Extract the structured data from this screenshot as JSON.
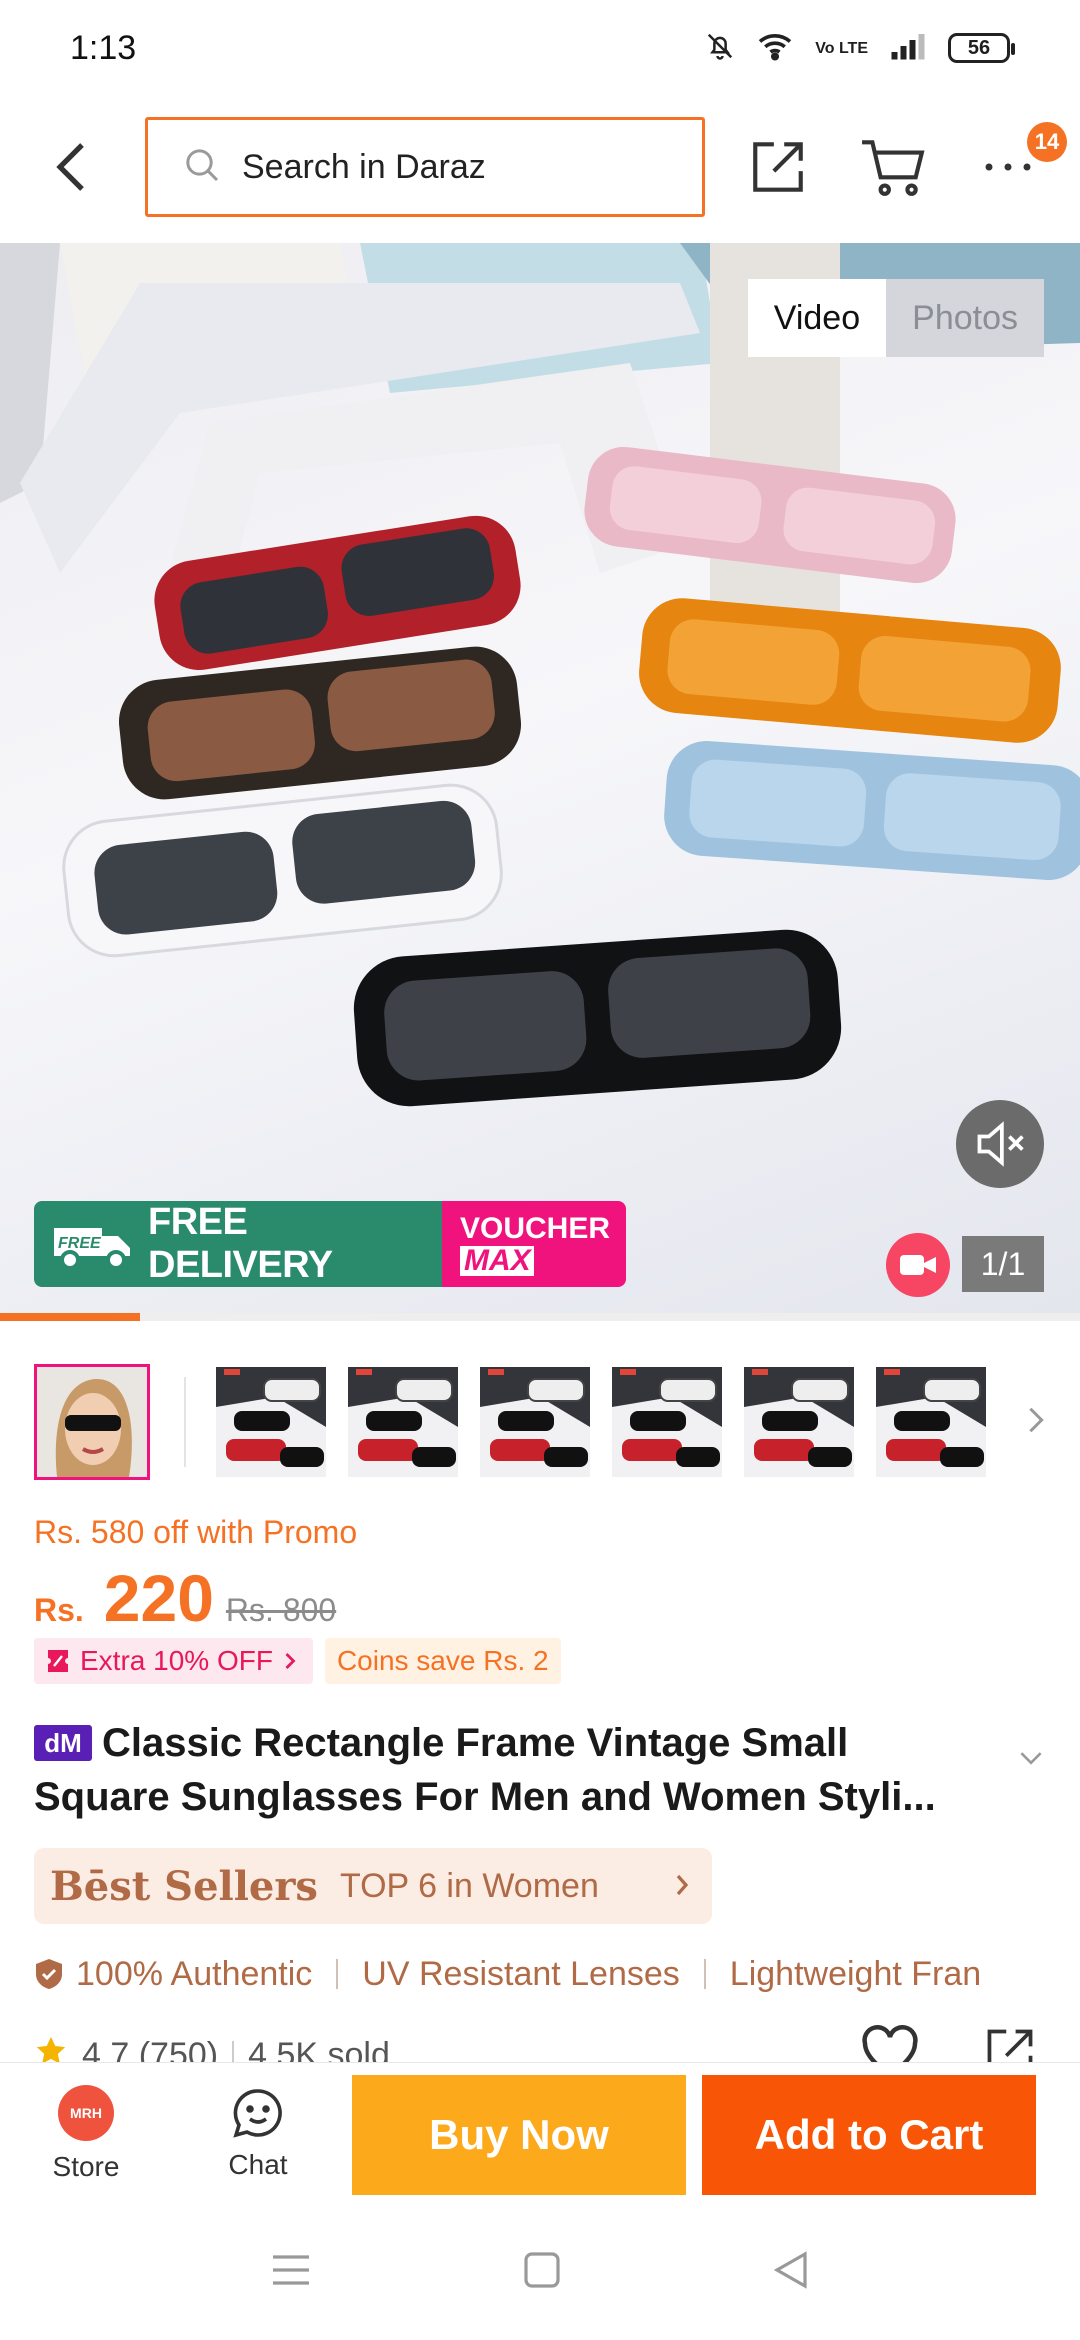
{
  "status_bar": {
    "time": "1:13",
    "network": "Vo LTE",
    "battery": "56"
  },
  "header": {
    "search_placeholder": "Search in Daraz",
    "cart_badge": "14"
  },
  "media": {
    "toggle_video": "Video",
    "toggle_photos": "Photos",
    "free_delivery": "FREE DELIVERY",
    "free_tag": "FREE",
    "voucher_line1": "VOUCHER",
    "voucher_line2": "MAX",
    "page_count": "1/1",
    "video_progress": 0.13
  },
  "thumbnails": {
    "count": 7,
    "selected_index": 0
  },
  "price": {
    "promo": "Rs. 580 off with Promo",
    "currency": "Rs.",
    "current": "220",
    "original": "Rs. 800",
    "chip_extra": "Extra 10% OFF",
    "chip_coins": "Coins save Rs. 2"
  },
  "product": {
    "brand_badge": "dM",
    "title": "Classic Rectangle Frame Vintage Small Square Sunglasses For Men and Women Styli..."
  },
  "best_sellers": {
    "title": "Bēst Sellers",
    "rank": "TOP 6 in Women"
  },
  "features": [
    "100% Authentic",
    "UV Resistant Lenses",
    "Lightweight Fran"
  ],
  "rating": {
    "score": "4.7 (750)",
    "sold": "4.5K sold"
  },
  "actions": {
    "store_logo": "MRH",
    "store": "Store",
    "chat": "Chat",
    "buy_now": "Buy Now",
    "add_to_cart": "Add to Cart"
  },
  "colors": {
    "accent": "#f57224",
    "buy_now": "#fca91c",
    "add_to_cart": "#f85606",
    "free_delivery": "#2a8b6c",
    "voucher": "#f0137d"
  }
}
